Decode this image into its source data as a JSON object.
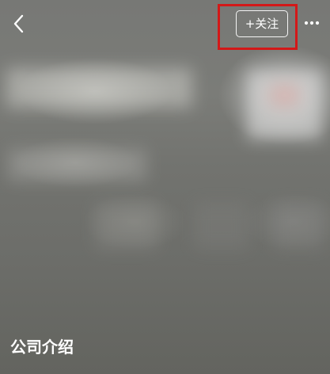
{
  "header": {
    "back_icon": "chevron-left-icon",
    "follow_label": "+关注",
    "more_icon": "ellipsis-horizontal-icon"
  },
  "page": {
    "section_title": "公司介绍"
  },
  "colors": {
    "highlight_border": "#d31818",
    "text": "#ffffff"
  }
}
